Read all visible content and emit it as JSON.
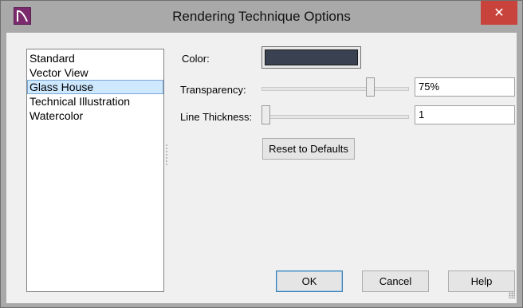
{
  "window": {
    "title": "Rendering Technique Options",
    "close_glyph": "✕",
    "icon": "app-logo-icon",
    "accent_close": "#c8433c"
  },
  "techniques": {
    "items": [
      "Standard",
      "Vector View",
      "Glass House",
      "Technical Illustration",
      "Watercolor"
    ],
    "selected": "Glass House"
  },
  "options": {
    "color_label": "Color:",
    "color_value": "#3a4252",
    "transparency_label": "Transparency:",
    "transparency_value": "75%",
    "transparency_level": 0.75,
    "line_thickness_label": "Line Thickness:",
    "line_thickness_value": "1",
    "line_thickness_level": 0.0,
    "reset_label": "Reset to Defaults"
  },
  "footer": {
    "ok_label": "OK",
    "cancel_label": "Cancel",
    "help_label": "Help"
  }
}
